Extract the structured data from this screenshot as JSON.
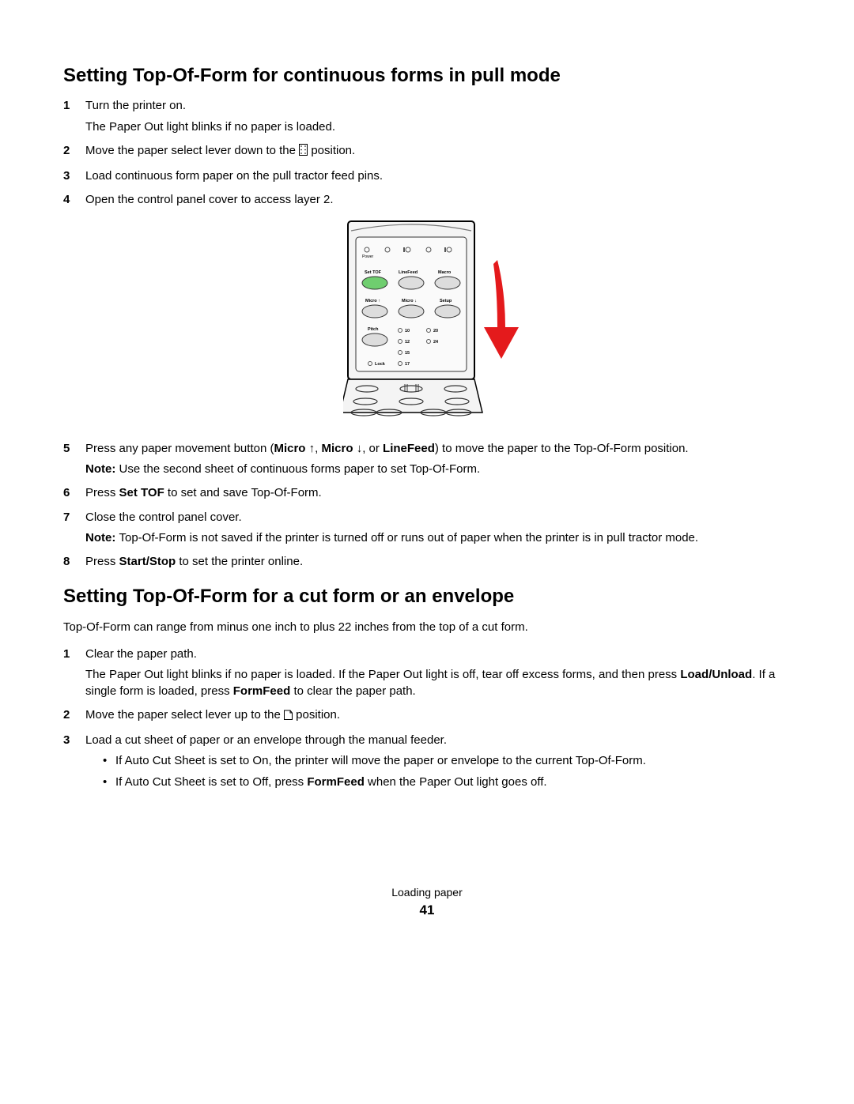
{
  "section1": {
    "heading": "Setting Top-Of-Form for continuous forms in pull mode",
    "steps": {
      "s1a": "Turn the printer on.",
      "s1b": "The Paper Out light blinks if no paper is loaded.",
      "s2a": "Move the paper select lever down to the ",
      "s2b": " position.",
      "s3": "Load continuous form paper on the pull tractor feed pins.",
      "s4": "Open the control panel cover to access layer 2.",
      "s5a": "Press any paper movement button (",
      "s5_micro": "Micro ",
      "s5_comma": ", ",
      "s5_or": ", or ",
      "s5_lf": "LineFeed",
      "s5b": ") to move the paper to the Top-Of-Form position.",
      "s5_note_label": "Note: ",
      "s5_note": "Use the second sheet of continuous forms paper to set Top-Of-Form.",
      "s6a": "Press ",
      "s6_bold": "Set TOF",
      "s6b": " to set and save Top-Of-Form.",
      "s7": "Close the control panel cover.",
      "s7_note_label": "Note: ",
      "s7_note": "Top-Of-Form is not saved if the printer is turned off or runs out of paper when the printer is in pull tractor mode.",
      "s8a": "Press ",
      "s8_bold": "Start/Stop",
      "s8b": " to set the printer online."
    }
  },
  "section2": {
    "heading": "Setting Top-Of-Form for a cut form or an envelope",
    "intro": "Top-Of-Form can range from minus one inch to plus 22 inches from the top of a cut form.",
    "steps": {
      "s1a": "Clear the paper path.",
      "s1b_a": "The Paper Out light blinks if no paper is loaded. If the Paper Out light is off, tear off excess forms, and then press ",
      "s1b_bold1": "Load/Unload",
      "s1b_mid": ". If a single form is loaded, press ",
      "s1b_bold2": "FormFeed",
      "s1b_end": " to clear the paper path.",
      "s2a": "Move the paper select lever up to the ",
      "s2b": " position.",
      "s3": "Load a cut sheet of paper or an envelope through the manual feeder.",
      "b1": "If Auto Cut Sheet is set to On, the printer will move the paper or envelope to the current Top-Of-Form.",
      "b2a": "If Auto Cut Sheet is set to Off, press ",
      "b2_bold": "FormFeed",
      "b2b": " when the Paper Out light goes off."
    }
  },
  "panel": {
    "labels": {
      "power": "Power",
      "settof": "Set TOF",
      "linefeed": "LineFeed",
      "macro": "Macro",
      "microup": "Micro ↑",
      "microdn": "Micro ↓",
      "setup": "Setup",
      "pitch": "Pitch",
      "lock": "Lock",
      "p10": "10",
      "p12": "12",
      "p15": "15",
      "p17": "17",
      "p20": "20",
      "p24": "24"
    }
  },
  "footer": {
    "section": "Loading paper",
    "page": "41"
  }
}
